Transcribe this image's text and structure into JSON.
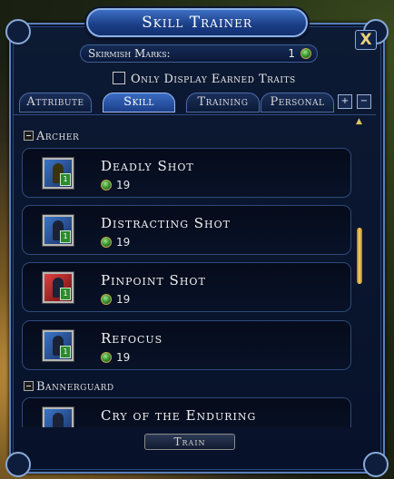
{
  "window": {
    "title": "Skill Trainer",
    "close_label": "X"
  },
  "marks": {
    "label": "Skirmish Marks:",
    "value": "1"
  },
  "earned_filter": {
    "label": "Only Display Earned Traits",
    "checked": false
  },
  "tabs": [
    {
      "label": "Attribute",
      "active": false
    },
    {
      "label": "Skill",
      "active": true
    },
    {
      "label": "Training",
      "active": false
    },
    {
      "label": "Personal",
      "active": false
    }
  ],
  "groups": [
    {
      "name": "Archer",
      "skills": [
        {
          "name": "Deadly Shot",
          "cost": "19",
          "icon": "deadly-shot-icon"
        },
        {
          "name": "Distracting Shot",
          "cost": "19",
          "icon": "distracting-shot-icon"
        },
        {
          "name": "Pinpoint Shot",
          "cost": "19",
          "icon": "pinpoint-shot-icon"
        },
        {
          "name": "Refocus",
          "cost": "19",
          "icon": "refocus-icon"
        }
      ]
    },
    {
      "name": "Bannerguard",
      "skills": [
        {
          "name": "Cry of the Enduring",
          "cost": "",
          "icon": "cry-of-the-enduring-icon"
        }
      ]
    }
  ],
  "train_button": "Train",
  "colors": {
    "frame": "#5a7fb8",
    "panel": "#07112a",
    "active_tab": "#3a6cc4",
    "scroll_thumb": "#ffd36a"
  }
}
